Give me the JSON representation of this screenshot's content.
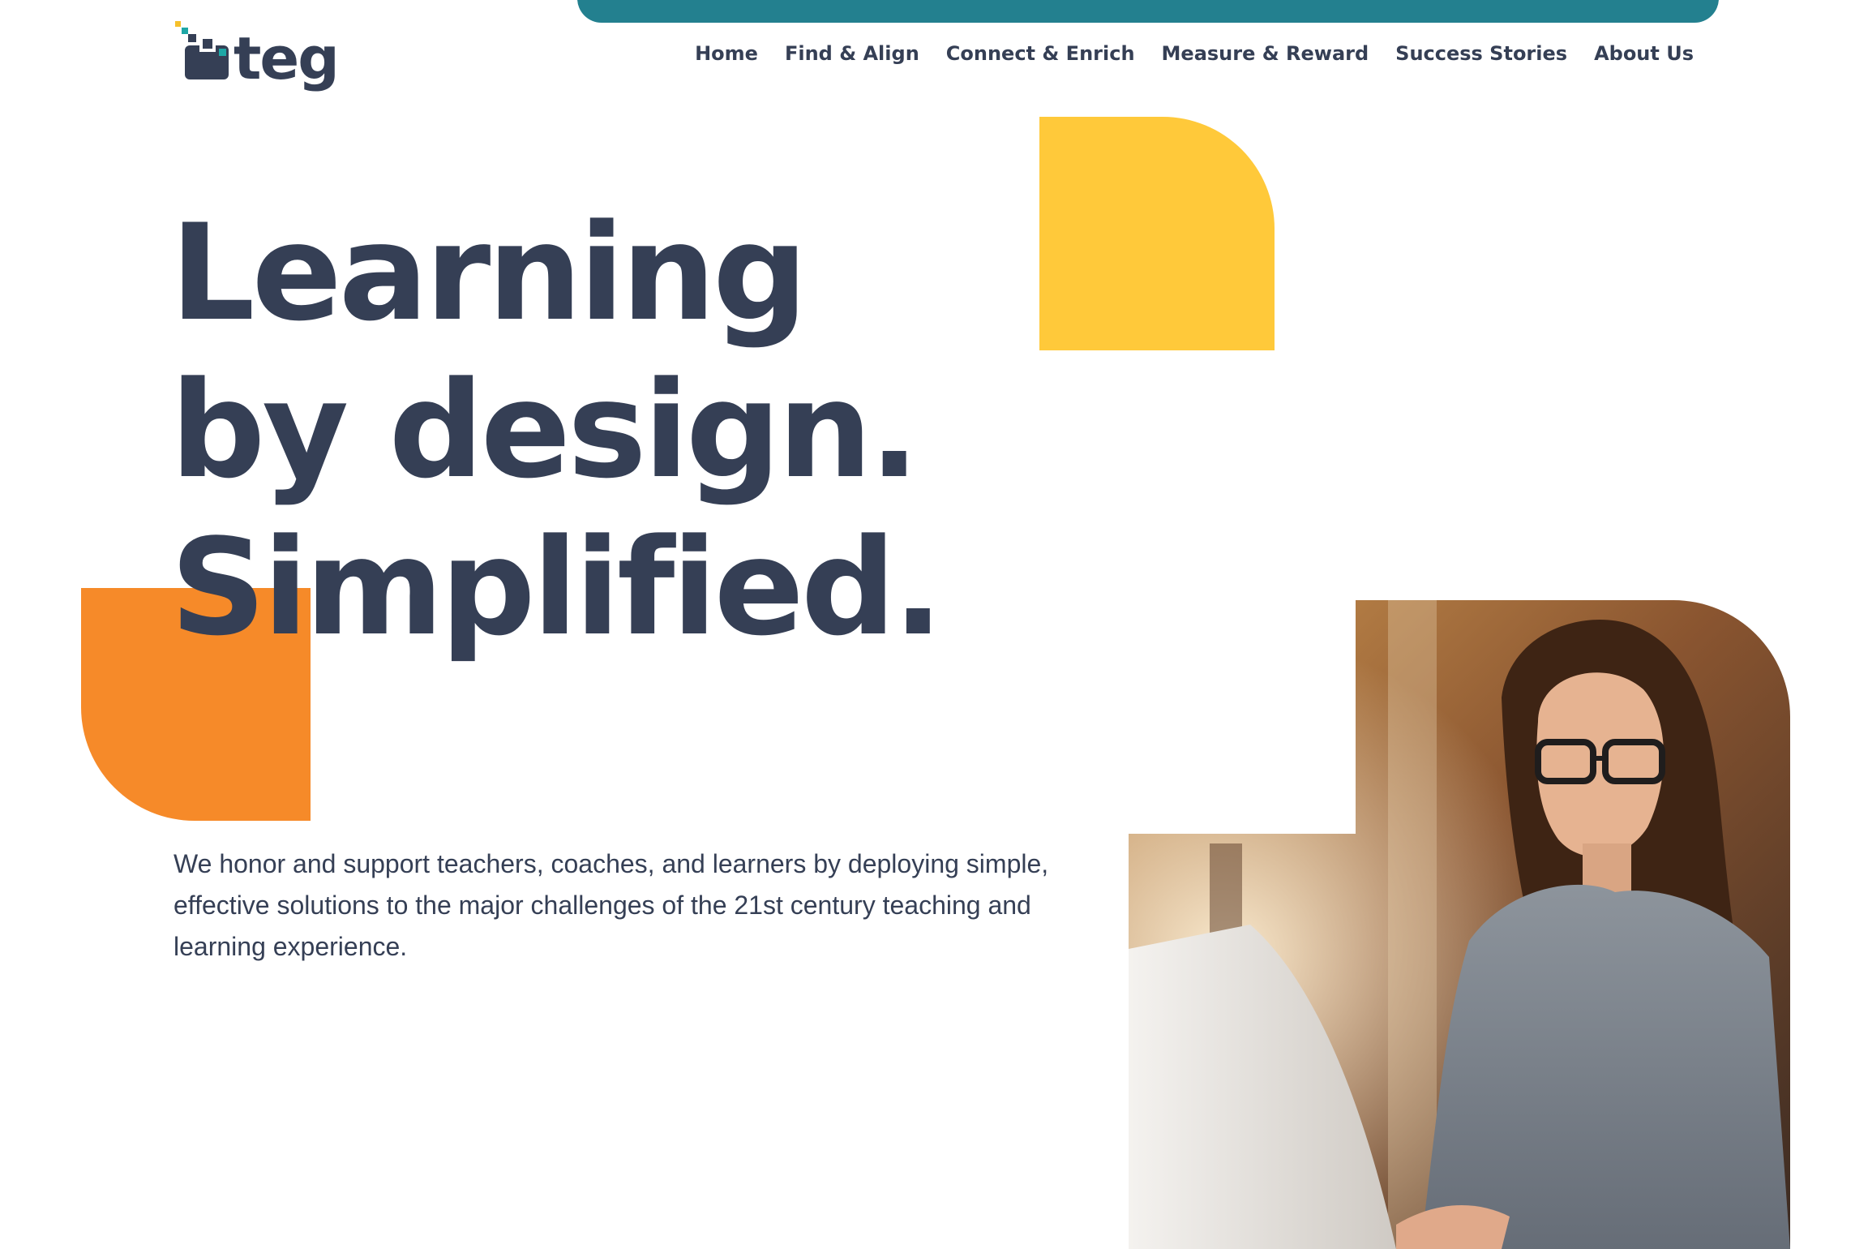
{
  "header": {
    "logo_text": "teg",
    "nav_items": [
      {
        "label": "Home"
      },
      {
        "label": "Find & Align"
      },
      {
        "label": "Connect & Enrich"
      },
      {
        "label": "Measure & Reward"
      },
      {
        "label": "Success Stories"
      },
      {
        "label": "About Us"
      }
    ]
  },
  "hero": {
    "headline_lines": [
      "Learning",
      "by design.",
      "Simplified."
    ],
    "intro": "We honor and support teachers, coaches, and learners by deploying simple, effective solutions to the major challenges of the 21st century teaching and learning experience."
  },
  "colors": {
    "accent_bar": "#23808f",
    "text_dark": "#353f55",
    "yellow": "#ffc93a",
    "orange": "#f68a29",
    "logo_teal": "#1ea7a6",
    "logo_yellow": "#f6c12b"
  },
  "icons": {
    "logo": "teg-pixel-logo-icon",
    "photo": "woman-at-laptop-photo"
  }
}
